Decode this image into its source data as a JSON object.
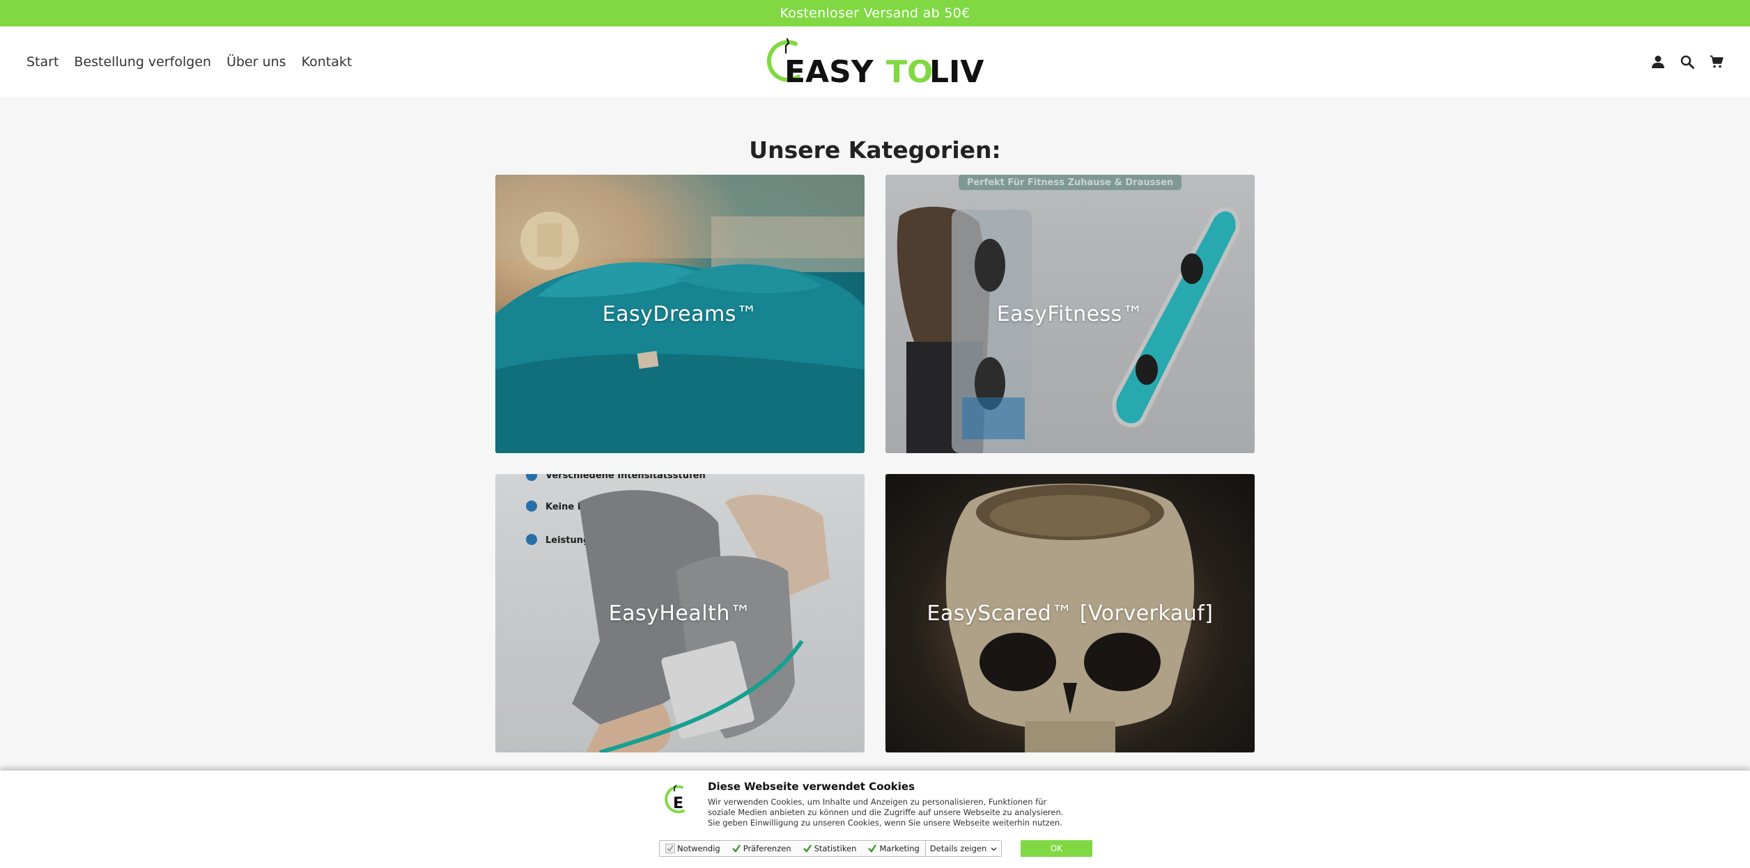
{
  "announcement": "Kostenloser Versand ab 50€",
  "nav": {
    "items": [
      {
        "label": "Start"
      },
      {
        "label": "Bestellung verfolgen"
      },
      {
        "label": "Über uns"
      },
      {
        "label": "Kontakt"
      }
    ]
  },
  "logo": {
    "part1": "EASY",
    "part2": "TO",
    "part3": "LIVE"
  },
  "header_icons": [
    "account-icon",
    "search-icon",
    "cart-icon"
  ],
  "section_title": "Unsere Kategorien:",
  "categories": [
    {
      "label": "EasyDreams™"
    },
    {
      "label": "EasyFitness™"
    },
    {
      "label": "EasyHealth™"
    },
    {
      "label": "EasyScared™ [Vorverkauf]"
    }
  ],
  "card_texts": {
    "fitness_banner": "Perfekt Für Fitness Zuhause & Draussen",
    "health_b1": "Verschiedene Intensitätsstufen",
    "health_b2": "Keine Kabel",
    "health_b3": "Leistungsstarker Akku"
  },
  "cookie": {
    "title": "Diese Webseite verwendet Cookies",
    "text": "Wir verwenden Cookies, um Inhalte und Anzeigen zu personalisieren, Funktionen für soziale Medien anbieten zu können und die Zugriffe auf unsere Webseite zu analysieren. Sie geben Einwilligung zu unseren Cookies, wenn Sie unsere Webseite weiterhin nutzen.",
    "options": [
      {
        "label": "Notwendig",
        "checked": true,
        "disabled": true
      },
      {
        "label": "Präferenzen",
        "checked": true
      },
      {
        "label": "Statistiken",
        "checked": true
      },
      {
        "label": "Marketing",
        "checked": true
      }
    ],
    "details_label": "Details zeigen",
    "ok_label": "OK"
  },
  "colors": {
    "brand_green": "#80d943",
    "text_dark": "#222222"
  }
}
